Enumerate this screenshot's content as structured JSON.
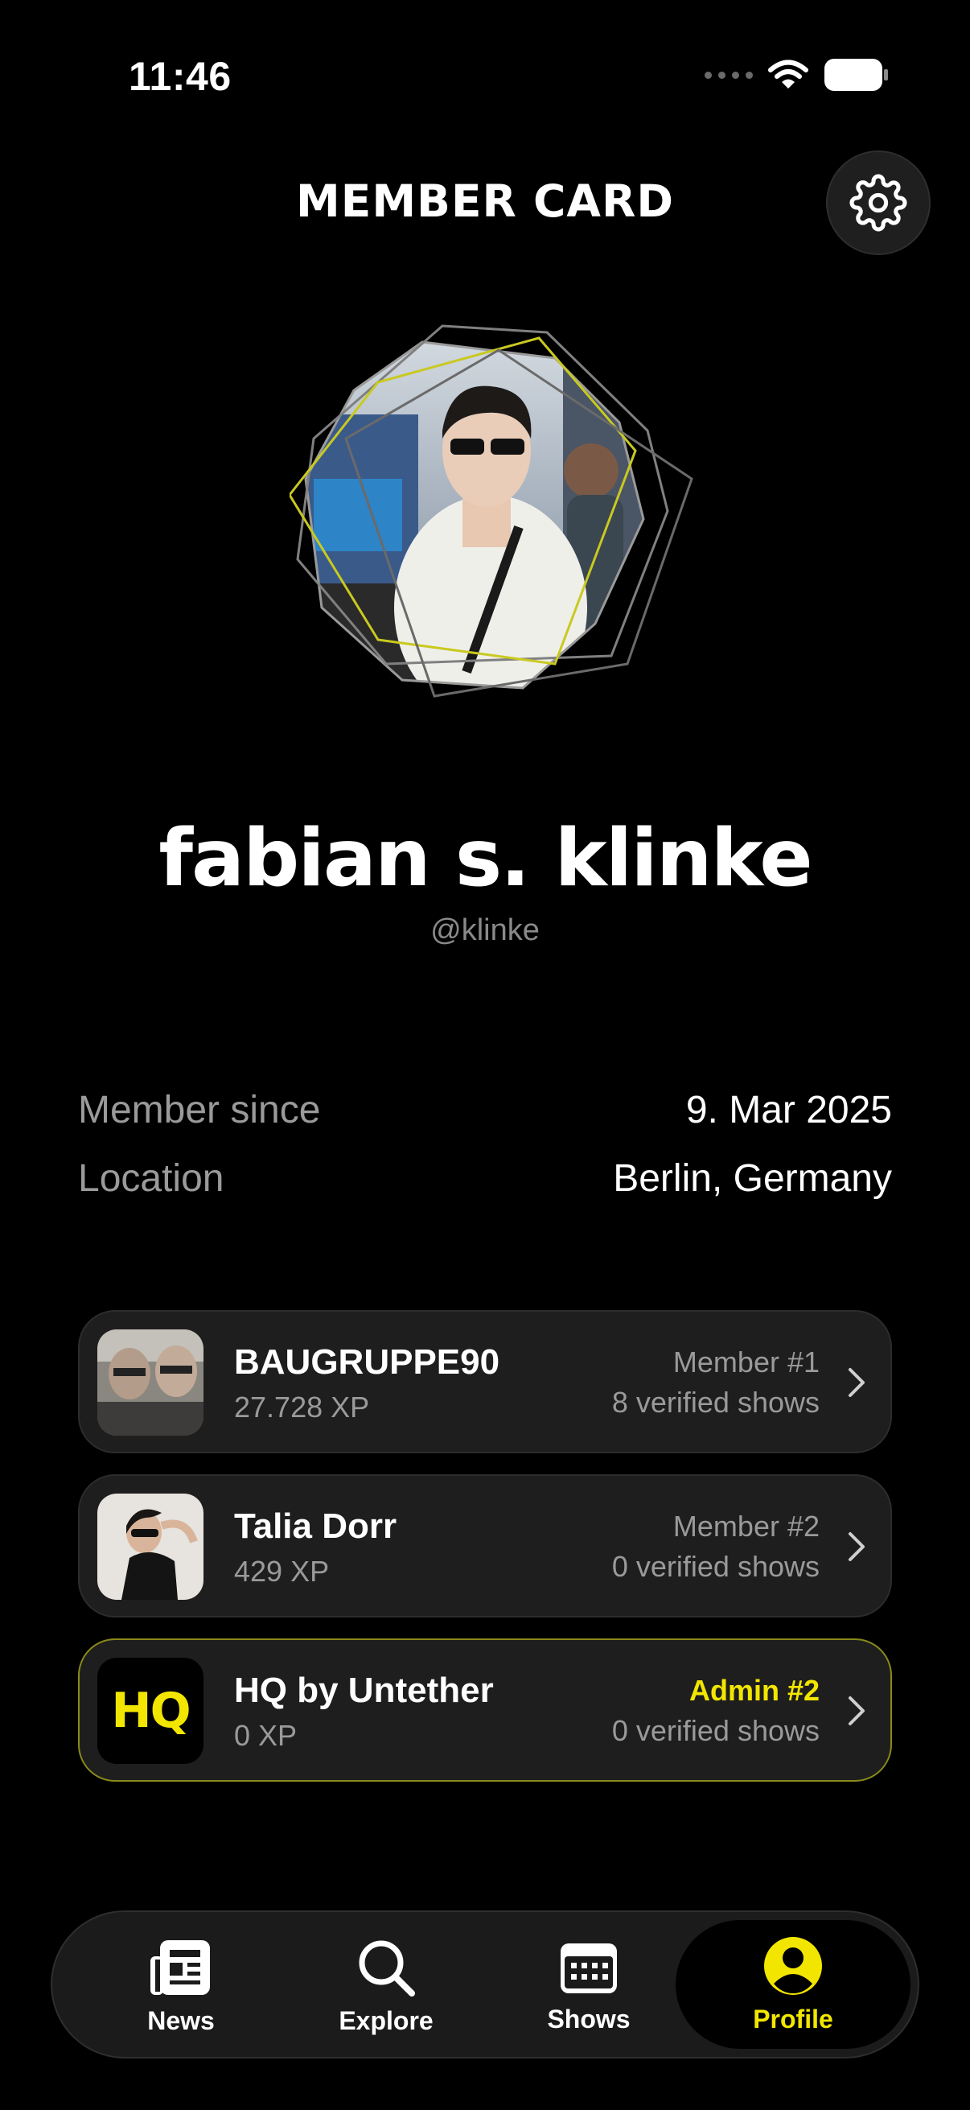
{
  "status_bar": {
    "time": "11:46"
  },
  "header": {
    "title": "MEMBER CARD"
  },
  "profile": {
    "name": "fabian s. klinke",
    "handle": "@klinke"
  },
  "info": [
    {
      "label": "Member since",
      "value": "9. Mar 2025"
    },
    {
      "label": "Location",
      "value": "Berlin, Germany"
    }
  ],
  "memberships": [
    {
      "name": "BAUGRUPPE90",
      "xp": "27.728 XP",
      "role": "Member #1",
      "shows": "8 verified shows"
    },
    {
      "name": "Talia Dorr",
      "xp": "429 XP",
      "role": "Member #2",
      "shows": "0 verified shows"
    },
    {
      "name": "HQ by Untether",
      "xp": "0 XP",
      "role": "Admin #2",
      "shows": "0 verified shows",
      "logo_text": "HQ"
    }
  ],
  "tabs": [
    {
      "label": "News",
      "icon": "news-icon"
    },
    {
      "label": "Explore",
      "icon": "search-icon"
    },
    {
      "label": "Shows",
      "icon": "calendar-icon"
    },
    {
      "label": "Profile",
      "icon": "profile-icon",
      "active": true
    }
  ],
  "colors": {
    "accent": "#f2e600",
    "background": "#000000",
    "card": "#1e1e1e"
  }
}
